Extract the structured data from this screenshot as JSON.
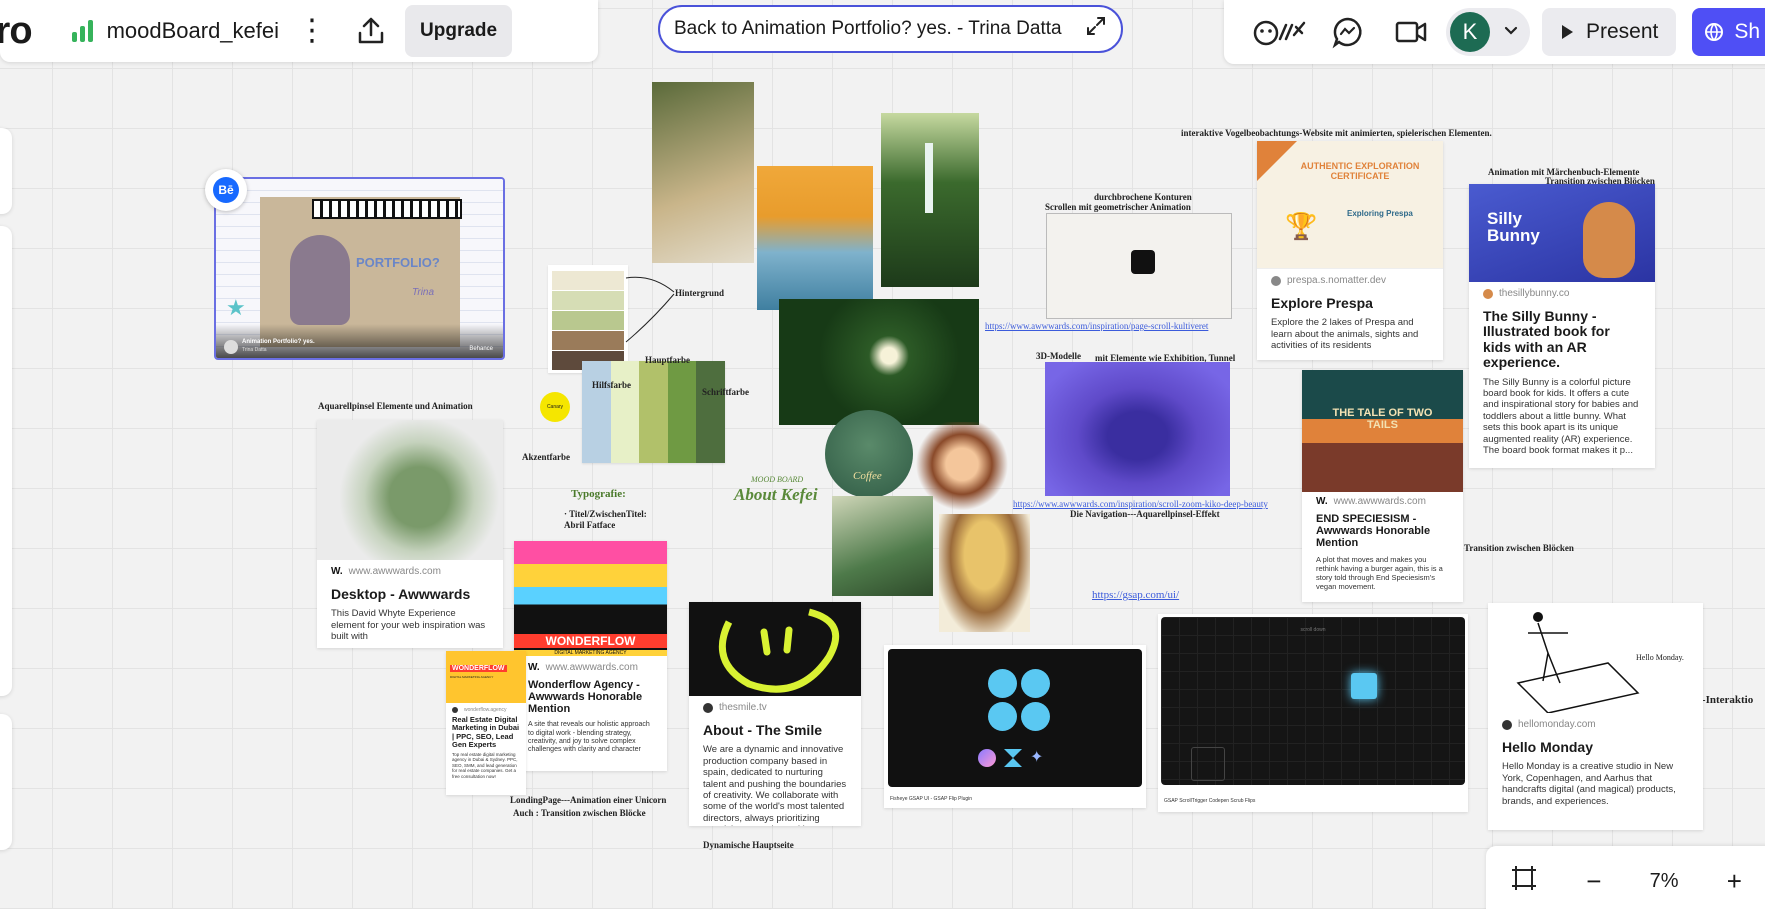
{
  "toolbar": {
    "logo": "iro",
    "board_name": "moodBoard_kefei",
    "upgrade_label": "Upgrade"
  },
  "link_bar": {
    "title": "Back to Animation Portfolio? yes. - Trina Datta"
  },
  "right_toolbar": {
    "avatar_initial": "K",
    "present_label": "Present",
    "share_label": "Sh"
  },
  "zoom": {
    "value": "7%"
  },
  "canvas": {
    "portfolio_card": {
      "badge": "Bē",
      "image_text": "PORTFOLIO?",
      "signature": "Trina",
      "caption": "Animation Portfolio? yes.",
      "byline": "Trina Datta",
      "source": "Behance"
    },
    "palette": {
      "labels": {
        "hintergrund": "Hintergrund",
        "hauptfarbe": "Hauptfarbe",
        "hilfsfarbe": "Hilfsfarbe",
        "schriftfarbe": "Schriftfarbe",
        "akzentfarbe": "Akzentfarbe",
        "accent_dot": "Canary"
      },
      "bg_swatches": [
        "#ede8d3",
        "#d6ddb5",
        "#b9c88f",
        "#9a7b5a",
        "#5e4a3c"
      ],
      "main_swatches": [
        "#b8d0e3",
        "#e7f0c7",
        "#b1c16a",
        "#6f9a43",
        "#4e6e3e"
      ],
      "accent_color": "#f5e600"
    },
    "notes": {
      "aquarell": "Aquarellpinsel Elemente und Animation",
      "typografie": "Typografie:",
      "titel": "· Titel/ZwischenTitel:",
      "font": "Abril Fatface",
      "moodboard_small": "MOOD BOARD",
      "about_kefei": "About Kefei",
      "vogel": "interaktive Vogelbeobachtungs-Website mit animierten, spielerischen Elementen.",
      "konturen": "durchbrochene Konturen",
      "scroll_geo": "Scrollen mit geometrischer Animation",
      "modelle": "3D-Modelle",
      "tunnel": "mit Elemente wie Exhibition,  Tunnel",
      "navigation": "Die Navigation---Aquarellpinsel-Effekt",
      "maerchen": "Animation mit Märchenbuch-Elemente",
      "transition1": "Transition zwischen Blöcken",
      "transition2": "Transition zwischen Blöcken",
      "hover": "Hover-Interaktio",
      "landing": "LondingPage---Animation einer Unicorn",
      "auch": "Auch : Transition zwischen Blöcke",
      "dynamisch": "Dynamische Hauptseite",
      "hello_monday_img": "Hello Monday."
    },
    "links": {
      "scroll_kultiveret": "https://www.awwwards.com/inspiration/page-scroll-kultiveret",
      "scroll_zoom": "https://www.awwwards.com/inspiration/scroll-zoom-kiko-deep-beauty",
      "gsap": "https://gsap.com/ui/"
    },
    "cards": {
      "desktop": {
        "url": "www.awwwards.com",
        "title": "Desktop - Awwwards",
        "desc": "This David Whyte Experience element for your web inspiration was built with"
      },
      "wonderflow": {
        "url": "www.awwwards.com",
        "title": "Wonderflow Agency - Awwwards Honorable Mention",
        "desc": "A site that reveals our holistic approach to digital work - blending strategy, creativity, and joy to solve complex challenges with clarity and character",
        "banner": "WONDERFLOW",
        "banner_sub": "DIGITAL MARKETING AGENCY"
      },
      "realestate": {
        "url": "wonderflow.agency",
        "title": "Real Estate Digital Marketing in Dubai | PPC, SEO, Lead Gen Experts",
        "desc": "Top real estate digital marketing agency in Dubai & Sydney. PPC, SEO, SMM, and lead generation for real estate companies. Get a free consultation now!",
        "banner": "WONDERFLOW",
        "banner_sub": "DIGITAL MARKETING AGENCY"
      },
      "smile": {
        "url": "thesmile.tv",
        "title": "About - The Smile",
        "desc": "We are a dynamic and innovative production company based in spain, dedicated to nurturing talent and pushing the boundaries of creativity. We collaborate with some of the world's most talented directors, always prioritizing creativity, empathy and integr..."
      },
      "prespa": {
        "url": "prespa.s.nomatter.dev",
        "title": "Explore Prespa",
        "desc": "Explore the 2 lakes of Prespa and learn about the animals, sights and activities of its residents",
        "cert_title": "AUTHENTIC EXPLORATION CERTIFICATE",
        "cert_sub": "Exploring Prespa"
      },
      "bunny": {
        "url": "thesillybunny.co",
        "title": "The Silly Bunny - Illustrated book for kids with an AR experience.",
        "desc": "The Silly Bunny is a colorful picture board book for kids. It offers a cute and inspirational story for babies and toddlers about a little bunny. What sets this book apart is its unique augmented reality (AR) experience. The board book format makes it p...",
        "img_text": "Silly Bunny"
      },
      "speciesism": {
        "url": "www.awwwards.com",
        "title": "END SPECIESISM - Awwwards Honorable Mention",
        "desc": "A plot that moves and makes you rethink having a burger again, this is a story told through End Speciesism's vegan movement.",
        "img_text": "THE TALE OF TWO TAILS"
      },
      "hellomonday": {
        "url": "hellomonday.com",
        "title": "Hello Monday",
        "desc": "Hello Monday is a creative studio in New York, Copenhagen, and Aarhus that handcrafts digital (and magical) products, brands, and experiences."
      },
      "gsap_flip": {
        "caption": "Fisheye GSAP UI - GSAP Flip Plugin"
      },
      "gsap_scroll": {
        "img_text": "scroll down",
        "caption": "GSAP ScrollTrigger Codepen Scrub Flips"
      }
    },
    "coffee_label": "Coffee"
  }
}
